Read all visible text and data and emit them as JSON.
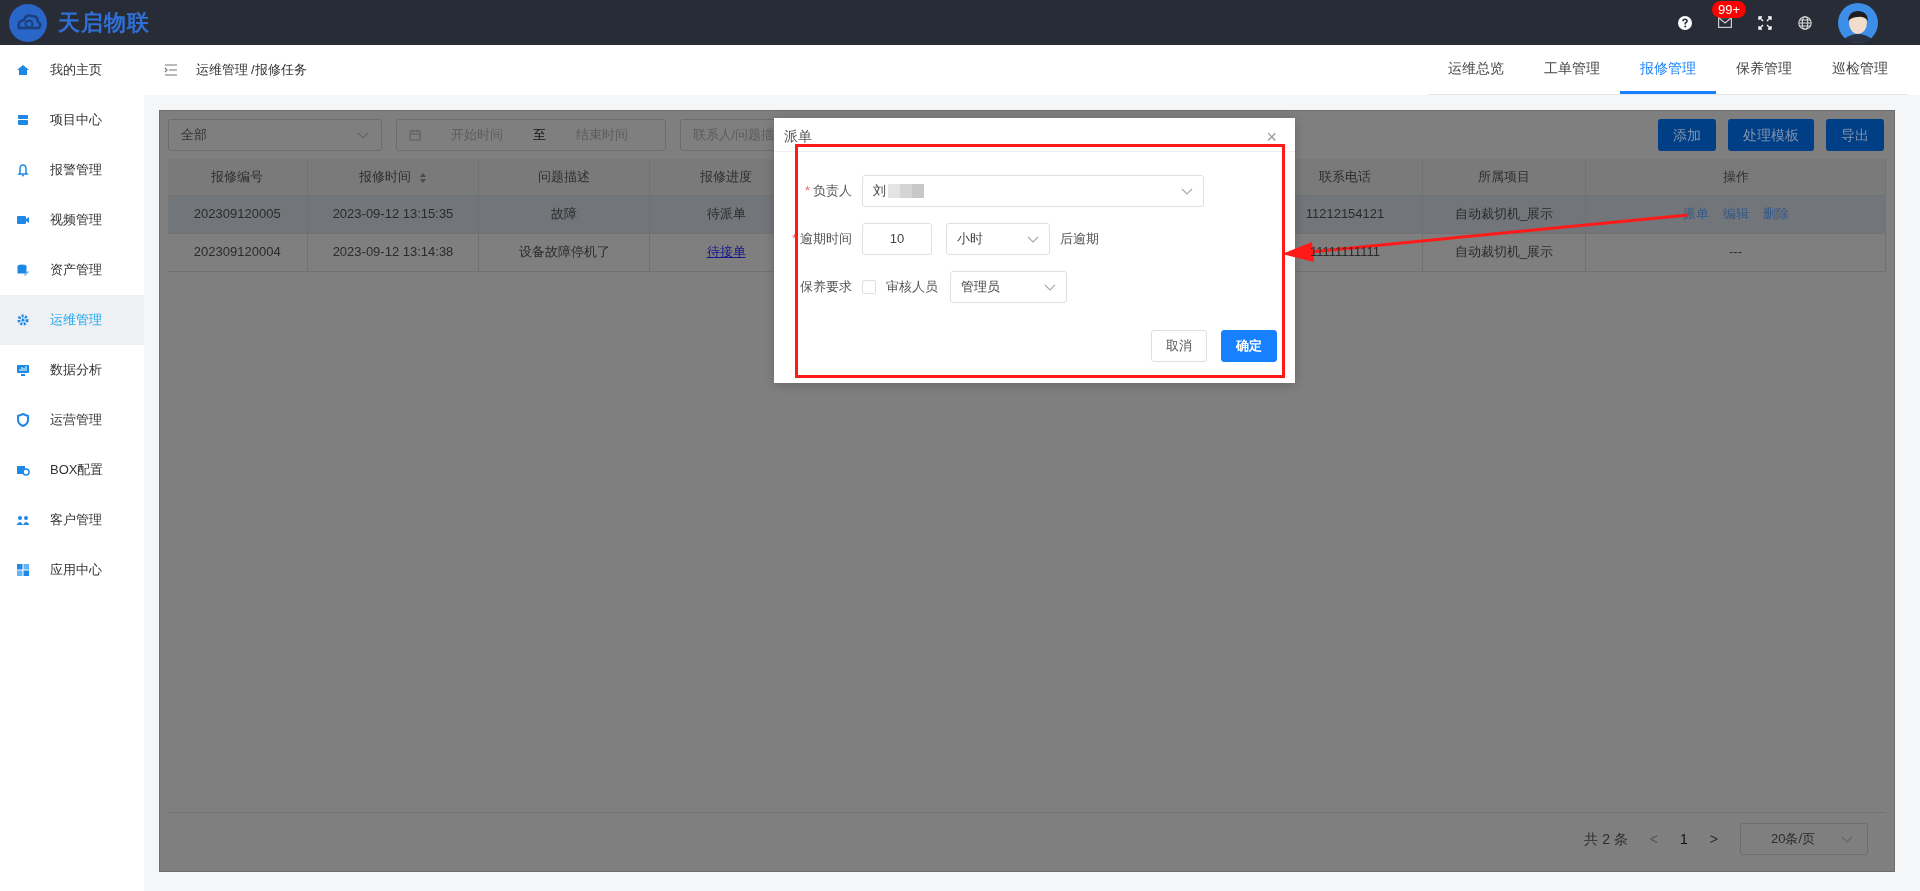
{
  "brand": {
    "name": "天启物联"
  },
  "topbar": {
    "badge": "99+"
  },
  "sidebar": {
    "items": [
      {
        "label": "我的主页",
        "selected": false
      },
      {
        "label": "项目中心",
        "selected": false
      },
      {
        "label": "报警管理",
        "selected": false
      },
      {
        "label": "视频管理",
        "selected": false
      },
      {
        "label": "资产管理",
        "selected": false
      },
      {
        "label": "运维管理",
        "selected": true
      },
      {
        "label": "数据分析",
        "selected": false
      },
      {
        "label": "运营管理",
        "selected": false
      },
      {
        "label": "BOX配置",
        "selected": false
      },
      {
        "label": "客户管理",
        "selected": false
      },
      {
        "label": "应用中心",
        "selected": false
      }
    ]
  },
  "breadcrumb": "运维管理 /报修任务",
  "nav_tabs": [
    {
      "label": "运维总览",
      "selected": false
    },
    {
      "label": "工单管理",
      "selected": false
    },
    {
      "label": "报修管理",
      "selected": true
    },
    {
      "label": "保养管理",
      "selected": false
    },
    {
      "label": "巡检管理",
      "selected": false
    }
  ],
  "filters": {
    "status": "全部",
    "start_placeholder": "开始时间",
    "separator": "至",
    "end_placeholder": "结束时间",
    "search_placeholder": "联系人/问题描"
  },
  "actions": [
    "添加",
    "处理模板",
    "导出"
  ],
  "table": {
    "columns": [
      "报修编号",
      "报修时间",
      "问题描述",
      "报修进度",
      "联系电话",
      "所属项目",
      "操作"
    ],
    "rows": [
      {
        "highlighted": true,
        "id": "202309120005",
        "time": "2023-09-12 13:15:35",
        "description": "故障",
        "progress": {
          "text": "待派单",
          "link": false
        },
        "phone": "11212154121",
        "project": "自动裁切机_展示",
        "operations": [
          {
            "label": "派单",
            "kind": "link"
          },
          {
            "label": "编辑",
            "kind": "link"
          },
          {
            "label": "删除",
            "kind": "link"
          }
        ]
      },
      {
        "highlighted": false,
        "id": "202309120004",
        "time": "2023-09-12 13:14:38",
        "description": "设备故障停机了",
        "progress": {
          "text": "待接单",
          "link": true
        },
        "phone": "11111111111",
        "project": "自动裁切机_展示",
        "operations": [
          {
            "label": "---",
            "kind": "text"
          }
        ]
      }
    ]
  },
  "pagination": {
    "total": "共 2 条",
    "prev": "<",
    "page": "1",
    "next": ">",
    "page_size": "20条/页"
  },
  "dialog": {
    "title": "派单",
    "close": "×",
    "assignee": {
      "mark": "*",
      "label": "负责人",
      "value": "刘"
    },
    "overdue": {
      "mark": "*",
      "label": "逾期时间",
      "value": "10",
      "unit": "小时",
      "suffix": "后逾期"
    },
    "maintenance": {
      "label": "保养要求",
      "checked": false,
      "checkbox_label": "审核人员",
      "reviewer": "管理员"
    },
    "cancel": "取消",
    "confirm": "确定"
  }
}
